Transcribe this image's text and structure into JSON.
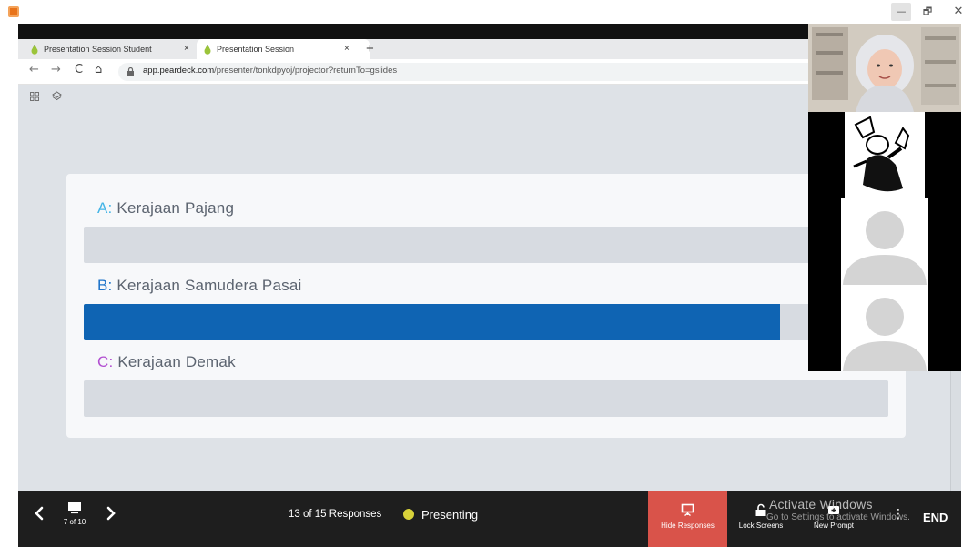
{
  "window": {
    "controls": {
      "minimize": "—",
      "maximize": "🗗",
      "close": "✕"
    }
  },
  "browser": {
    "tabs": [
      {
        "label": "Presentation Session Student",
        "close": "×",
        "active": false
      },
      {
        "label": "Presentation Session",
        "close": "×",
        "active": true
      }
    ],
    "new_tab": "+",
    "nav": {
      "back": "←",
      "forward": "→",
      "reload": "C",
      "home": "⌂"
    },
    "url_domain": "app.peardeck.com",
    "url_path": "/presenter/tonkdpyoj/projector?returnTo=gslides"
  },
  "question": {
    "options": [
      {
        "letter": "A:",
        "label": "Kerajaan Pajang",
        "letter_color": "#45b5e6",
        "share": 0.0
      },
      {
        "letter": "B:",
        "label": "Kerajaan Samudera Pasai",
        "letter_color": "#1e73c9",
        "share": 0.865
      },
      {
        "letter": "C:",
        "label": "Kerajaan Demak",
        "letter_color": "#b24fd1",
        "share": 0.0
      }
    ],
    "bar_color": "#0f64b3"
  },
  "presenter_bar": {
    "prev": "<",
    "next": ">",
    "slide_counter": "7 of 10",
    "responses": "13 of 15 Responses",
    "status": "Presenting",
    "status_color": "#d8d23a",
    "hide_responses": "Hide Responses",
    "hide_color": "#d9534a",
    "lock_screens": "Lock Screens",
    "new_prompt": "New Prompt",
    "more": "⋮",
    "end": "END"
  },
  "watermark": {
    "line1": "Activate Windows",
    "line2": "Go to Settings to activate Windows."
  },
  "video_tiles": [
    {
      "kind": "camera"
    },
    {
      "kind": "drawing"
    },
    {
      "kind": "placeholder"
    },
    {
      "kind": "placeholder"
    }
  ]
}
